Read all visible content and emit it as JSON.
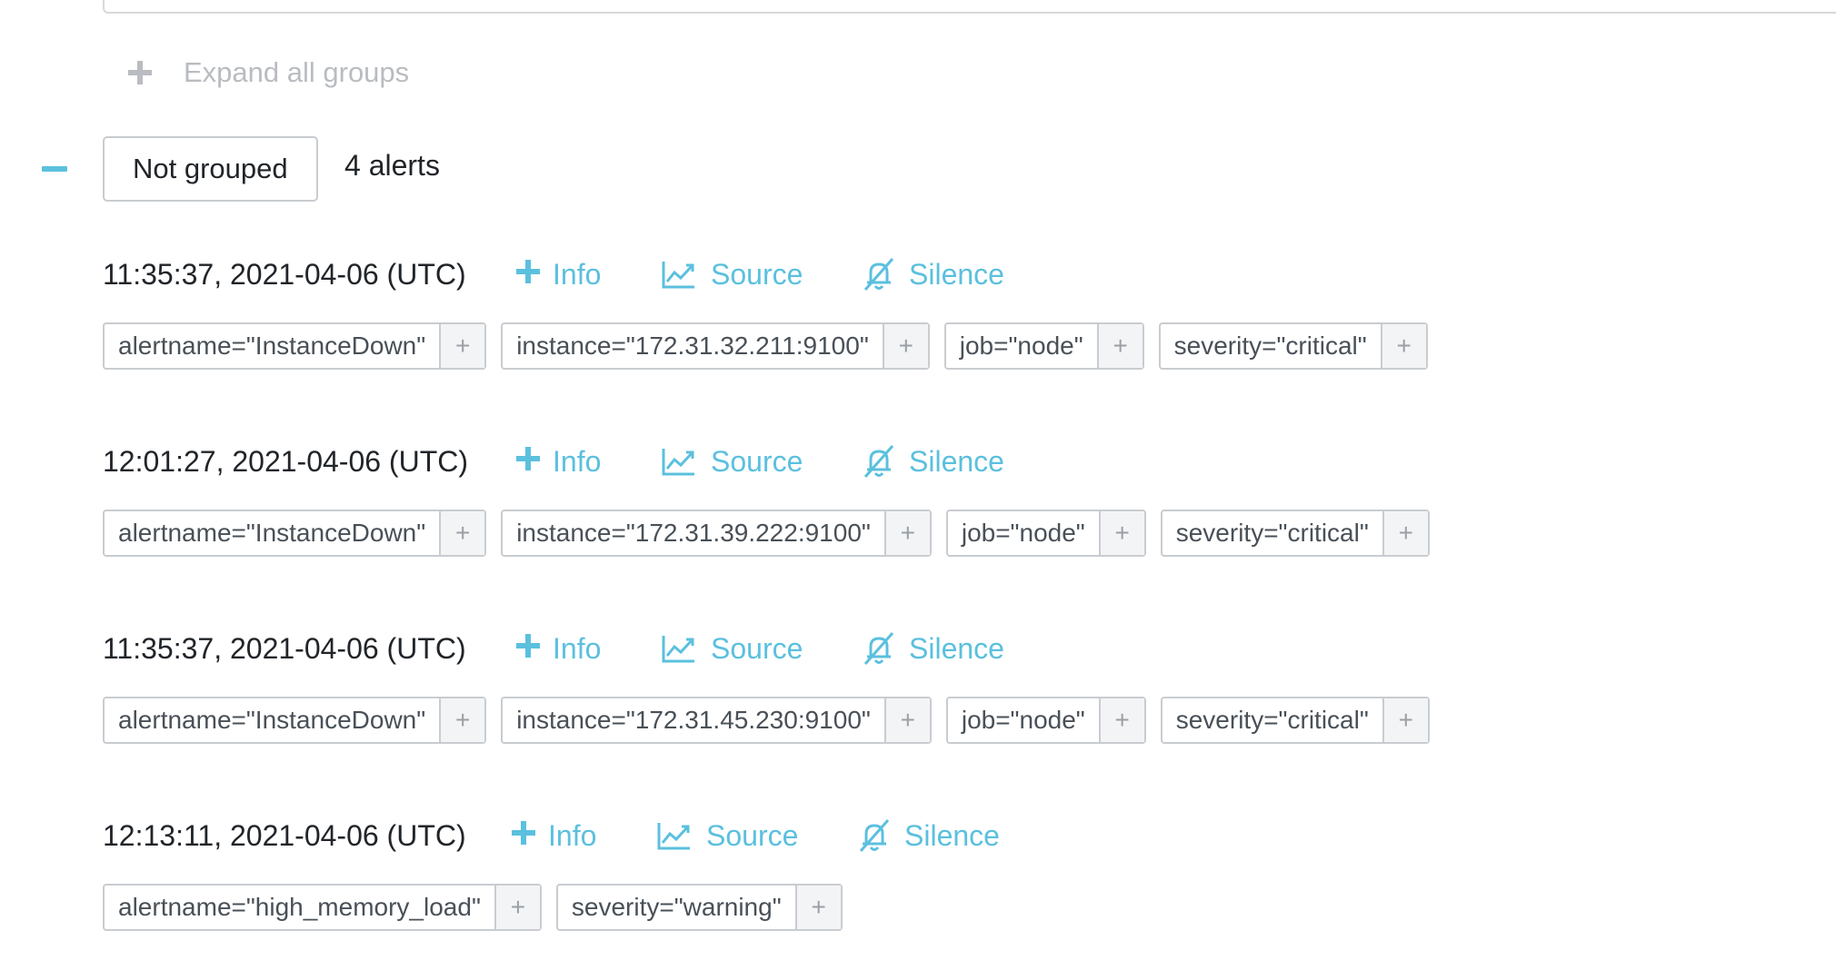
{
  "toolbar": {
    "expand_all_label": "Expand all groups"
  },
  "group": {
    "name": "Not grouped",
    "count_label": "4 alerts"
  },
  "actions": {
    "info": "Info",
    "source": "Source",
    "silence": "Silence",
    "add_filter": "+"
  },
  "colors": {
    "accent": "#5bc0de",
    "muted_text": "#b9bcc0",
    "border": "#c9ccd0"
  },
  "alerts": [
    {
      "timestamp": "11:35:37, 2021-04-06 (UTC)",
      "labels": [
        "alertname=\"InstanceDown\"",
        "instance=\"172.31.32.211:9100\"",
        "job=\"node\"",
        "severity=\"critical\""
      ]
    },
    {
      "timestamp": "12:01:27, 2021-04-06 (UTC)",
      "labels": [
        "alertname=\"InstanceDown\"",
        "instance=\"172.31.39.222:9100\"",
        "job=\"node\"",
        "severity=\"critical\""
      ]
    },
    {
      "timestamp": "11:35:37, 2021-04-06 (UTC)",
      "labels": [
        "alertname=\"InstanceDown\"",
        "instance=\"172.31.45.230:9100\"",
        "job=\"node\"",
        "severity=\"critical\""
      ]
    },
    {
      "timestamp": "12:13:11, 2021-04-06 (UTC)",
      "labels": [
        "alertname=\"high_memory_load\"",
        "severity=\"warning\""
      ]
    }
  ]
}
